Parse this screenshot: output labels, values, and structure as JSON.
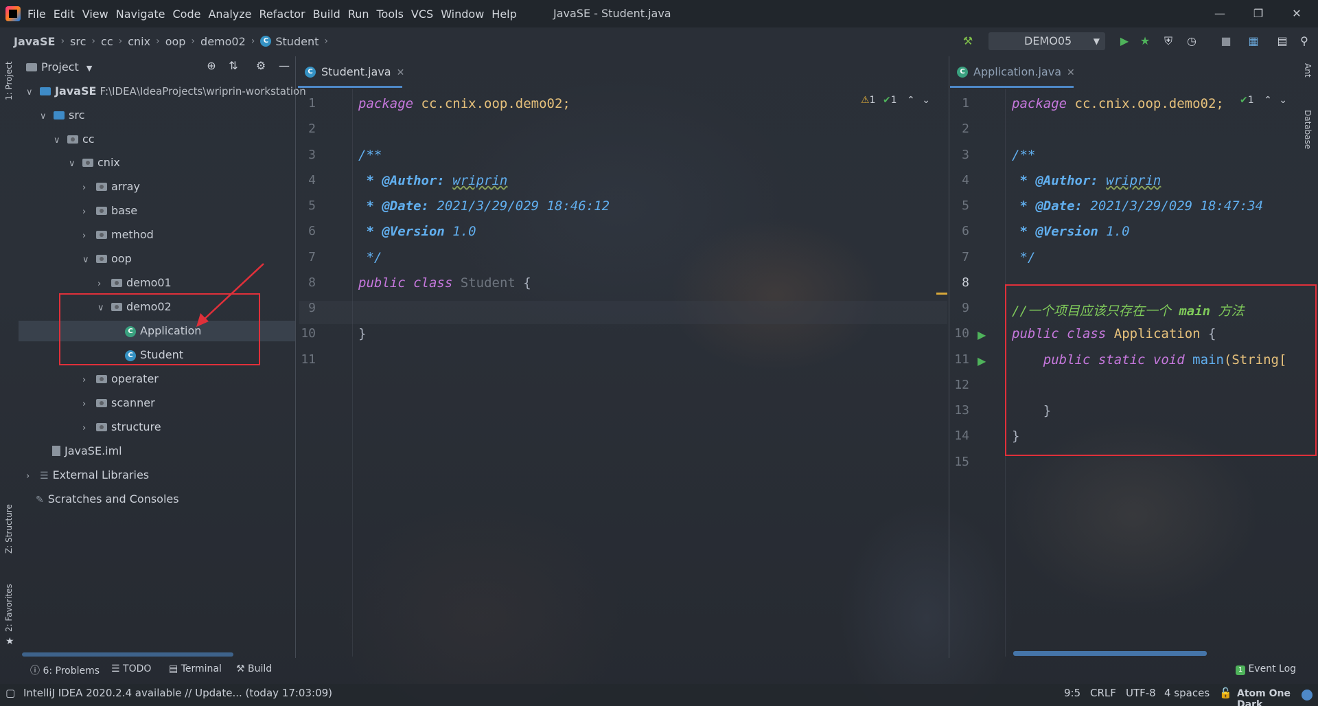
{
  "window": {
    "title": "JavaSE - Student.java",
    "menu": [
      "File",
      "Edit",
      "View",
      "Navigate",
      "Code",
      "Analyze",
      "Refactor",
      "Build",
      "Run",
      "Tools",
      "VCS",
      "Window",
      "Help"
    ]
  },
  "navbar": {
    "breadcrumbs": [
      "JavaSE",
      "src",
      "cc",
      "cnix",
      "oop",
      "demo02",
      "Student"
    ],
    "run_config": "DEMO05"
  },
  "left_stripe": {
    "project": "1: Project",
    "structure": "Z: Structure",
    "favorites": "2: Favorites"
  },
  "right_stripe": {
    "ant": "Ant",
    "database": "Database"
  },
  "project_panel": {
    "title": "Project",
    "tree": [
      {
        "label": "JavaSE",
        "path": "F:\\IDEA\\IdeaProjects\\wriprin-workstation"
      },
      {
        "label": "src"
      },
      {
        "label": "cc"
      },
      {
        "label": "cnix"
      },
      {
        "label": "array"
      },
      {
        "label": "base"
      },
      {
        "label": "method"
      },
      {
        "label": "oop"
      },
      {
        "label": "demo01"
      },
      {
        "label": "demo02"
      },
      {
        "label": "Application"
      },
      {
        "label": "Student"
      },
      {
        "label": "operater"
      },
      {
        "label": "scanner"
      },
      {
        "label": "structure"
      },
      {
        "label": "JavaSE.iml"
      },
      {
        "label": "External Libraries"
      },
      {
        "label": "Scratches and Consoles"
      }
    ]
  },
  "editor_left": {
    "tab": "Student.java",
    "inspections": {
      "warnings": "1",
      "ok": "1"
    },
    "line_numbers": [
      "1",
      "2",
      "3",
      "4",
      "5",
      "6",
      "7",
      "8",
      "9",
      "10",
      "11"
    ],
    "package_kw": "package",
    "package_name": "cc.cnix.oop.demo02;",
    "doc_open": "/**",
    "author_tag": " * @Author:",
    "author": "wriprin",
    "date_tag": " * @Date:",
    "date": "2021/3/29/029 18:46:12",
    "version_tag": " * @Version",
    "version": "1.0",
    "doc_close": " */",
    "public_kw": "public",
    "class_kw": "class",
    "class_name": "Student",
    "brace_open": "{",
    "brace_close": "}"
  },
  "editor_right": {
    "tab": "Application.java",
    "inspections": {
      "ok": "1"
    },
    "line_numbers": [
      "1",
      "2",
      "3",
      "4",
      "5",
      "6",
      "7",
      "8",
      "9",
      "10",
      "11",
      "12",
      "13",
      "14",
      "15"
    ],
    "package_kw": "package",
    "package_name": "cc.cnix.oop.demo02;",
    "doc_open": "/**",
    "author_tag": " * @Author:",
    "author": "wriprin",
    "date_tag": " * @Date:",
    "date": "2021/3/29/029 18:47:34",
    "version_tag": " * @Version",
    "version": "1.0",
    "doc_close": " */",
    "comment_a": "//一个项目应该只存在一个 ",
    "comment_b": "main",
    "comment_c": " 方法",
    "public_kw": "public",
    "class_kw": "class",
    "class_name": "Application",
    "brace_open": "{",
    "method_mods": "public static void",
    "method_name": "main",
    "method_rest": "(String[",
    "inner_close": "}",
    "outer_close": "}"
  },
  "bottom_tools": {
    "problems": "6: Problems",
    "todo": "TODO",
    "terminal": "Terminal",
    "build": "Build",
    "event_log": "Event Log",
    "event_count": "1"
  },
  "status": {
    "message": "IntelliJ IDEA 2020.2.4 available // Update... (today 17:03:09)",
    "position": "9:5",
    "line_sep": "CRLF",
    "encoding": "UTF-8",
    "indent": "4 spaces",
    "theme": "Atom One Dark"
  },
  "colors": {
    "accent": "#4e88c7",
    "annotation": "#e0303a"
  }
}
